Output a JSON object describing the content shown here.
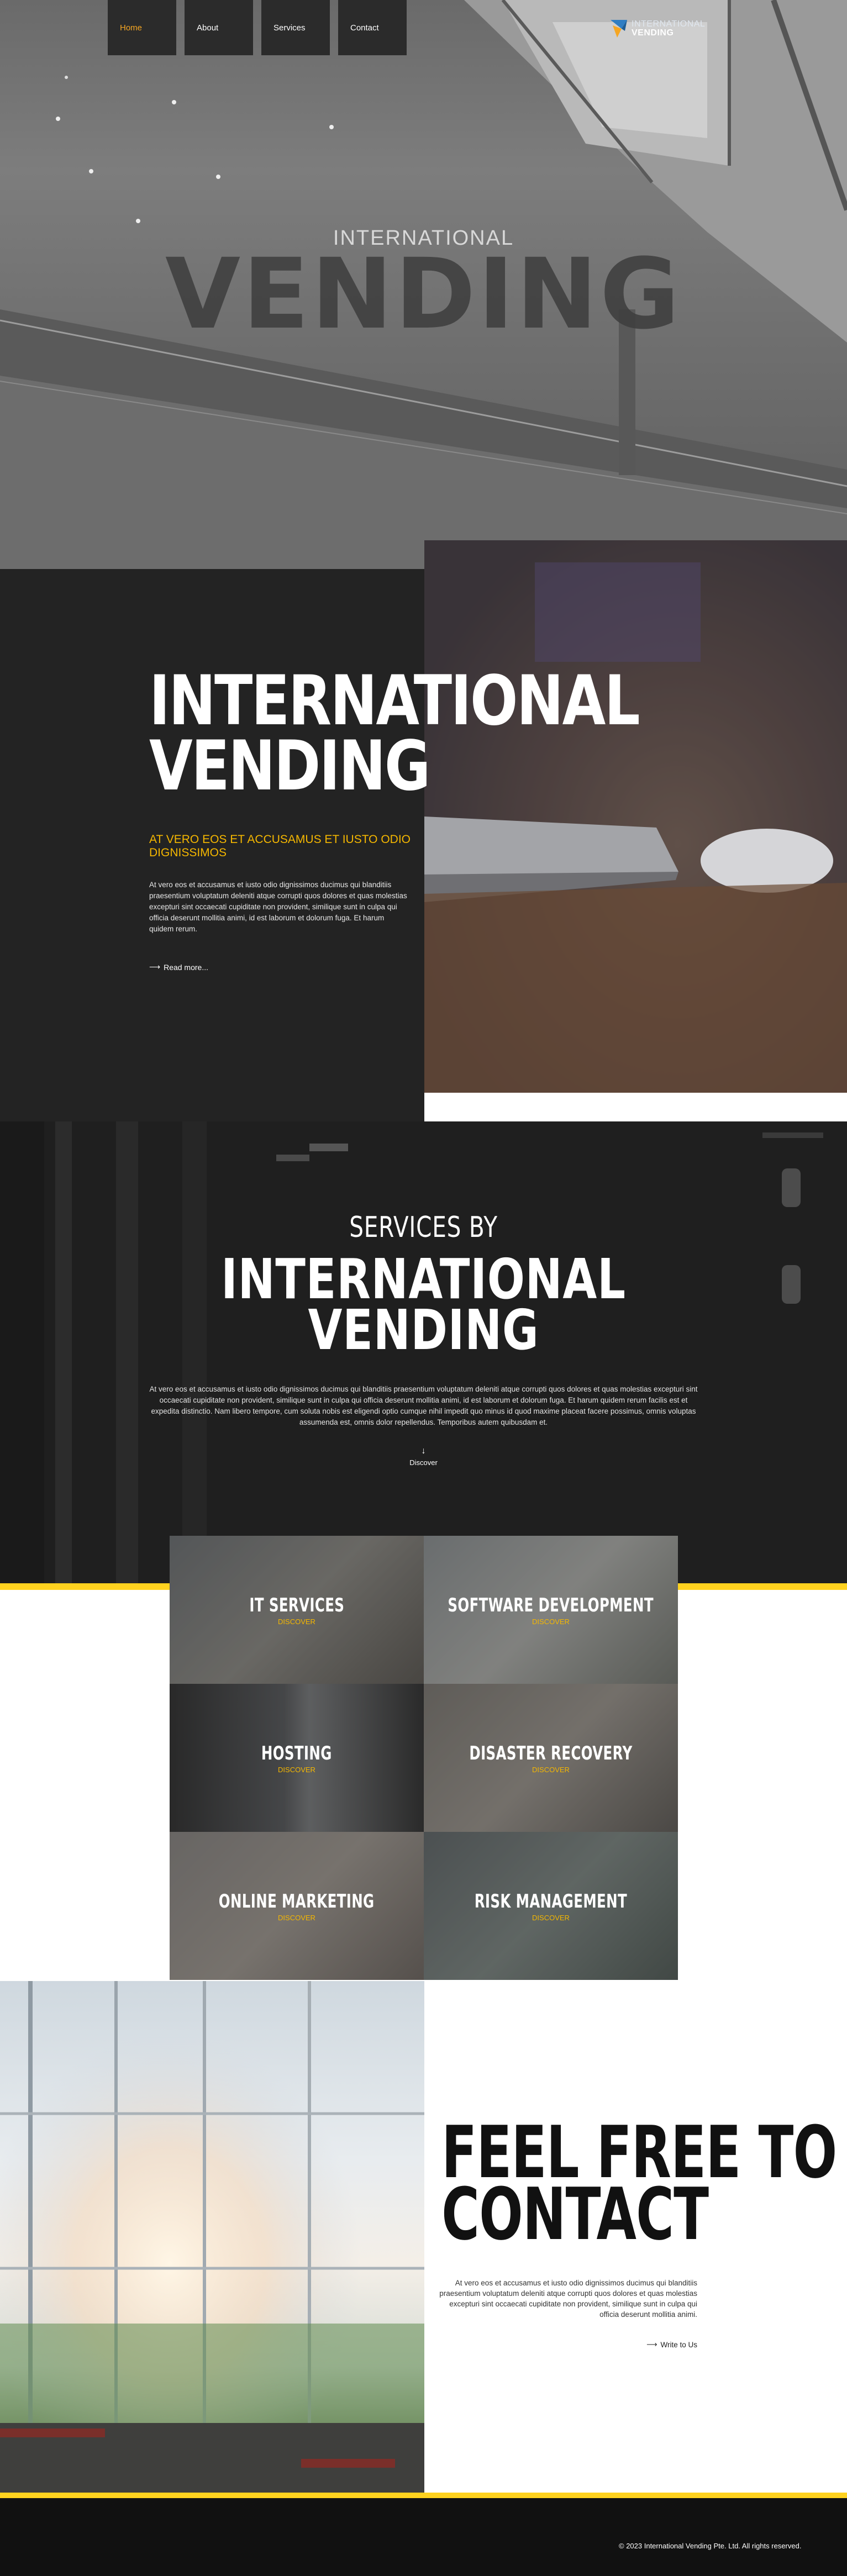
{
  "nav": {
    "items": [
      {
        "label": "Home"
      },
      {
        "label": "About"
      },
      {
        "label": "Services"
      },
      {
        "label": "Contact"
      }
    ]
  },
  "logo": {
    "line1": "INTERNATIONAL",
    "line2": "VENDING"
  },
  "hero": {
    "small": "INTERNATIONAL",
    "big": "VENDING"
  },
  "about": {
    "title_line1": "INTERNATIONAL",
    "title_line2": "VENDING",
    "subtitle": "AT VERO EOS ET ACCUSAMUS ET IUSTO ODIO DIGNISSIMOS",
    "text": "At vero eos et accusamus et iusto odio dignissimos ducimus qui blanditiis praesentium voluptatum deleniti atque corrupti quos dolores et quas molestias excepturi sint occaecati cupiditate non provident, similique sunt in culpa qui officia deserunt mollitia animi, id est laborum et dolorum fuga. Et harum quidem rerum.",
    "link": "Read more..."
  },
  "services": {
    "small": "SERVICES BY",
    "big_line1": "INTERNATIONAL",
    "big_line2": "VENDING",
    "text": "At vero eos et accusamus et iusto odio dignissimos ducimus qui blanditiis praesentium voluptatum deleniti atque corrupti quos dolores et quas molestias excepturi sint occaecati cupiditate non provident, similique sunt in culpa qui officia deserunt mollitia animi, id est laborum et dolorum fuga. Et harum quidem rerum facilis est et expedita distinctio. Nam libero tempore, cum soluta nobis est eligendi optio cumque nihil impedit quo minus id quod maxime placeat facere possimus, omnis voluptas assumenda est, omnis dolor repellendus. Temporibus autem quibusdam et.",
    "arrow": "↓",
    "discover": "Discover",
    "tiles": [
      {
        "name": "IT SERVICES",
        "action": "DISCOVER"
      },
      {
        "name": "SOFTWARE DEVELOPMENT",
        "action": "DISCOVER"
      },
      {
        "name": "HOSTING",
        "action": "DISCOVER"
      },
      {
        "name": "DISASTER RECOVERY",
        "action": "DISCOVER"
      },
      {
        "name": "ONLINE MARKETING",
        "action": "DISCOVER"
      },
      {
        "name": "RISK MANAGEMENT",
        "action": "DISCOVER"
      }
    ]
  },
  "contact": {
    "title_line1": "FEEL FREE TO",
    "title_line2": "CONTACT",
    "text": "At vero eos et accusamus et iusto odio dignissimos ducimus qui blanditiis praesentium voluptatum deleniti atque corrupti quos dolores et quas molestias excepturi sint occaecati cupiditate non provident, similique sunt in culpa qui officia deserunt mollitia animi.",
    "link": "Write to Us"
  },
  "footer": {
    "copyright": "© 2023 International Vending Pte. Ltd. All rights reserved."
  },
  "colors": {
    "accent": "#f5a623",
    "yellow": "#ffd21f",
    "dark": "#232323"
  }
}
